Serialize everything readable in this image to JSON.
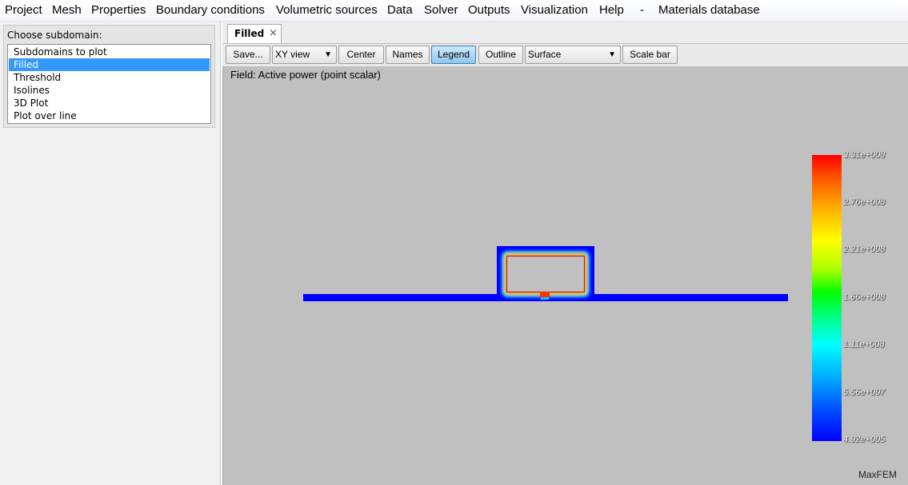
{
  "menu": [
    "Project",
    "Mesh",
    "Properties",
    "Boundary conditions",
    "Volumetric sources",
    "Data",
    "Solver",
    "Outputs",
    "Visualization",
    "Help",
    "-",
    "Materials database"
  ],
  "left_panel": {
    "label": "Choose subdomain:",
    "items": [
      "Subdomains to plot",
      "Filled",
      "Threshold",
      "Isolines",
      "3D Plot",
      "Plot over line"
    ],
    "selected": "Filled"
  },
  "tab": {
    "label": "Filled",
    "close_glyph": "×"
  },
  "toolbar": {
    "save": "Save...",
    "view": "XY view",
    "center": "Center",
    "names": "Names",
    "legend": "Legend",
    "outline": "Outline",
    "surface": "Surface",
    "scalebar": "Scale bar",
    "dropdown_glyph": "▼"
  },
  "viewport": {
    "field_label": "Field: Active power (point scalar)",
    "legend_labels": [
      "3.31e+008",
      "2.76e+008",
      "2.21e+008",
      "1.66e+008",
      "1.11e+008",
      "5.56e+007",
      "4.92e+005"
    ],
    "brand": "MaxFEM"
  },
  "colors": {
    "selection": "#3399ff",
    "viewport_bg": "#c0c0c0",
    "field_min": "#0000ff",
    "field_max": "#ff0000"
  }
}
